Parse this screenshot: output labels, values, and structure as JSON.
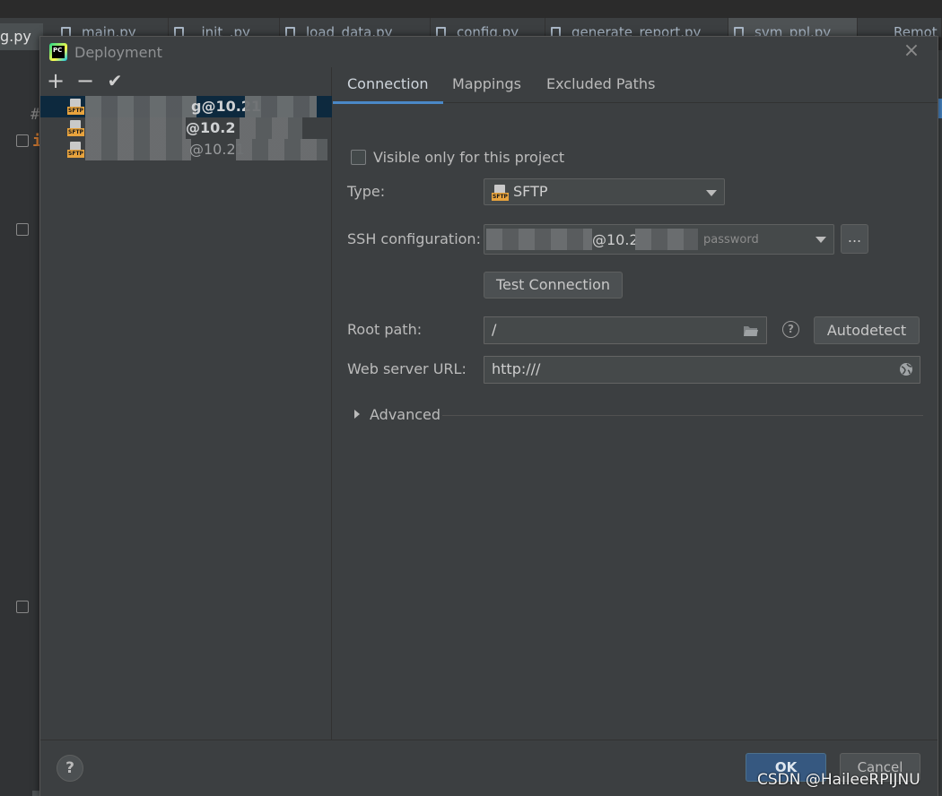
{
  "background": {
    "left_tab": "g.py",
    "tabs": [
      "main.py",
      "_init_.py",
      "load_data.py",
      "config.py",
      "generate_report.py",
      "svm_ppl.py",
      "Remot"
    ],
    "code_line_1": "#",
    "code_line_2": "i"
  },
  "dialog": {
    "title": "Deployment",
    "app_logo": "PC",
    "close_icon": "×"
  },
  "toolbar": {
    "add_icon": "+",
    "remove_icon": "−",
    "check_icon": "✔"
  },
  "servers": [
    {
      "label": "g@10.21",
      "type": "SFTP",
      "selected": true
    },
    {
      "label": "@10.2",
      "type": "SFTP",
      "selected": false
    },
    {
      "label": "@10.21",
      "type": "SFTP",
      "selected": false
    }
  ],
  "tabs": {
    "connection": "Connection",
    "mappings": "Mappings",
    "excluded": "Excluded Paths"
  },
  "connection": {
    "visible_label": "Visible only for this project",
    "type_label": "Type:",
    "type_value": "SFTP",
    "ssh_label": "SSH configuration:",
    "ssh_host": "@10.2",
    "ssh_auth": "password",
    "ssh_more": "...",
    "test_button": "Test Connection",
    "root_label": "Root path:",
    "root_value": "/",
    "help_icon": "?",
    "autodetect_button": "Autodetect",
    "web_label": "Web server URL:",
    "web_value": "http:///",
    "advanced_label": "Advanced"
  },
  "footer": {
    "help": "?",
    "ok": "OK",
    "cancel": "Cancel"
  },
  "watermark": "CSDN @HaileeRPIJNU",
  "colors": {
    "accent": "#4a88c7",
    "selection": "#0d293e",
    "ok_button": "#365880",
    "sftp_tag": "#e8a33d"
  }
}
